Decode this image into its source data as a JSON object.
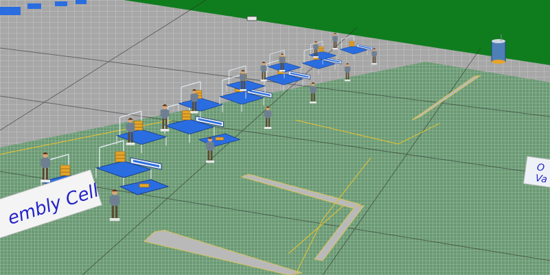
{
  "scene": {
    "colors": {
      "ground_green": "#0f7d1e",
      "floor_gray": "#a9a9a9",
      "floor_green": "#6f9f78",
      "floor_grid": "#d8d8d8",
      "aisle": "#b7b7b7",
      "table_blue": "#2a6de0",
      "frame": "#dfe7ee",
      "box": "#e6a52a",
      "label_text": "#2323c8"
    },
    "floor_labels": {
      "assembly_cell": "embly Cell",
      "right_line1": "O",
      "right_line2": "Va"
    },
    "icons": {
      "worker": "worker-figure-icon",
      "workstation": "workstation-icon",
      "parts_stack": "parts-box-stack-icon",
      "conveyor": "conveyor-icon",
      "storage_tank": "storage-tank-icon"
    }
  }
}
